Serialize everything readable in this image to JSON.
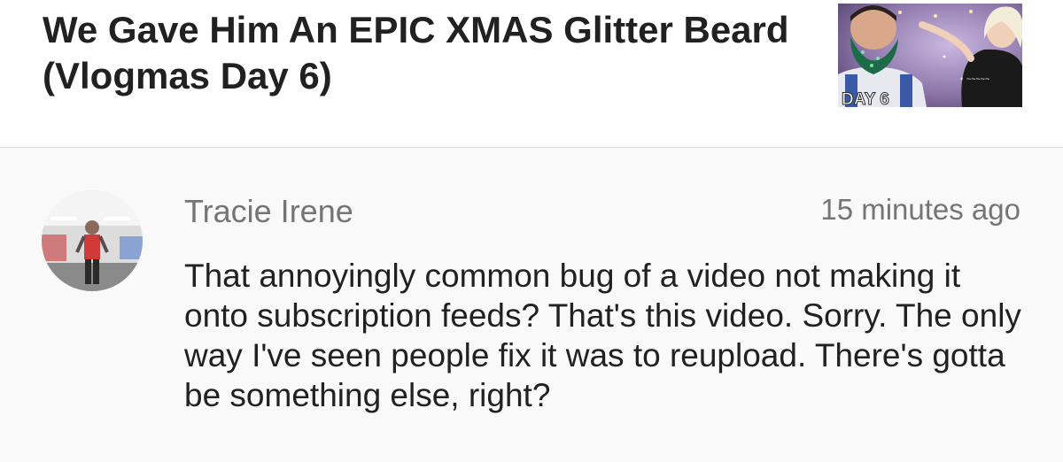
{
  "video": {
    "title": "We Gave Him An EPIC XMAS Glitter Beard (Vlogmas Day 6)",
    "thumbnail_label": "DAY 6"
  },
  "comment": {
    "author": "Tracie Irene",
    "timestamp": "15 minutes ago",
    "text": "That annoyingly common bug of a video not making it onto subscription feeds? That's this video. Sorry. The only way I've seen people fix it was to reupload. There's gotta be something else, right?"
  },
  "colors": {
    "background": "#f9f9f9",
    "header_background": "#ffffff",
    "primary_text": "#212121",
    "secondary_text": "#757575"
  }
}
